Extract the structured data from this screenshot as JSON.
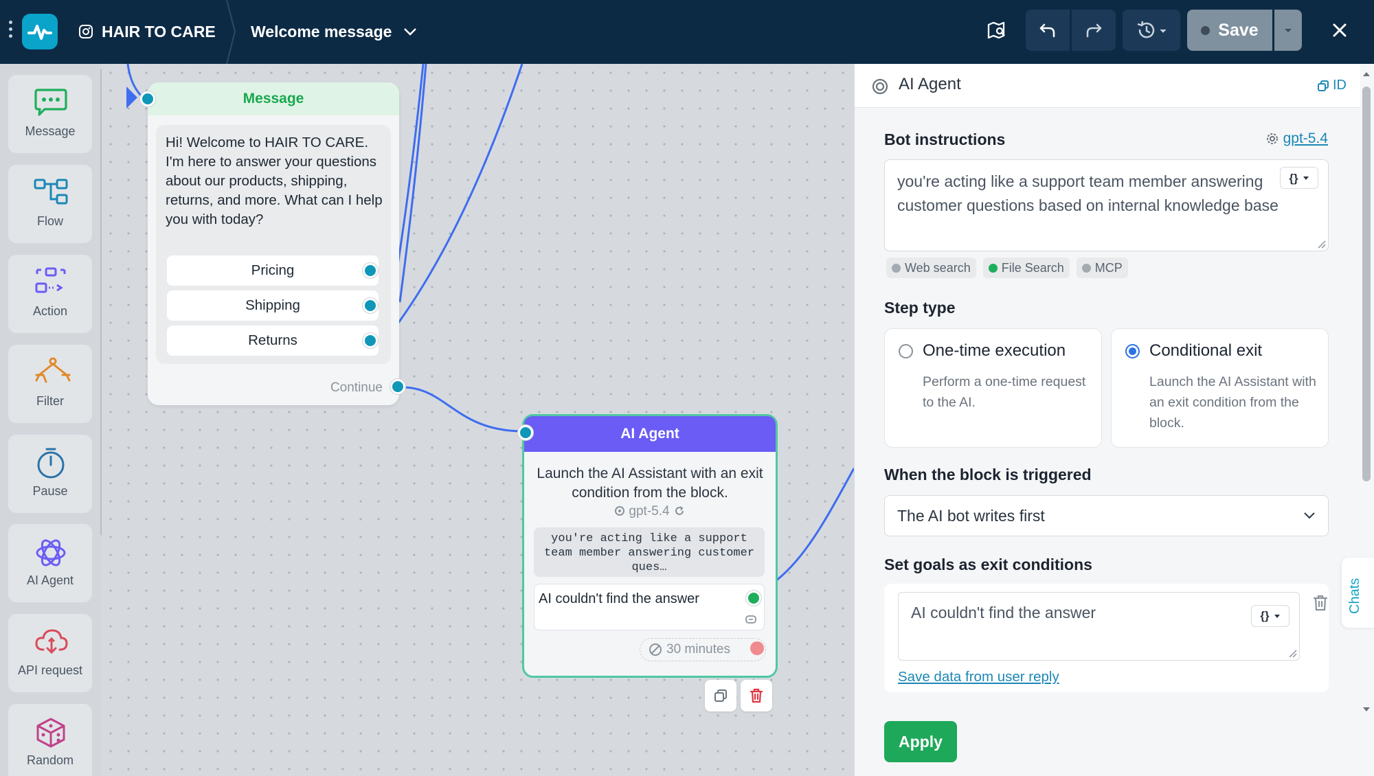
{
  "topbar": {
    "project_name": "HAIR TO CARE",
    "flow_name": "Welcome message",
    "save_label": "Save"
  },
  "palette": [
    {
      "label": "Message",
      "icon": "message-icon"
    },
    {
      "label": "Flow",
      "icon": "flow-icon"
    },
    {
      "label": "Action",
      "icon": "action-icon"
    },
    {
      "label": "Filter",
      "icon": "filter-icon"
    },
    {
      "label": "Pause",
      "icon": "pause-icon"
    },
    {
      "label": "AI Agent",
      "icon": "ai-agent-icon"
    },
    {
      "label": "API request",
      "icon": "api-request-icon"
    },
    {
      "label": "Random",
      "icon": "random-icon"
    }
  ],
  "message_node": {
    "title": "Message",
    "text": "Hi! Welcome to HAIR TO CARE. I'm here to answer your questions about our products, shipping, returns, and more. What can I help you with today?",
    "buttons": [
      "Pricing",
      "Shipping",
      "Returns"
    ],
    "continue_label": "Continue"
  },
  "ai_node": {
    "title": "AI Agent",
    "description": "Launch the AI Assistant with an exit condition from the block.",
    "model": "gpt-5.4",
    "instructions_preview": "you're acting like a support team member answering customer ques…",
    "goal": "AI couldn't find the answer",
    "timeout": "30 minutes"
  },
  "panel": {
    "title": "AI Agent",
    "id_label": "ID",
    "bot_instructions_label": "Bot instructions",
    "model_link": "gpt-5.4",
    "instructions_text": "you're acting like a support team member answering customer questions based on internal knowledge base",
    "tools": [
      {
        "label": "Web search",
        "enabled": false
      },
      {
        "label": "File Search",
        "enabled": true
      },
      {
        "label": "MCP",
        "enabled": false
      }
    ],
    "step_type_label": "Step type",
    "step_types": [
      {
        "title": "One-time execution",
        "desc": "Perform a one-time request to the AI.",
        "selected": false
      },
      {
        "title": "Conditional exit",
        "desc": "Launch the AI Assistant with an exit condition from the block.",
        "selected": true
      }
    ],
    "trigger_label": "When the block is triggered",
    "trigger_value": "The AI bot writes first",
    "goals_label": "Set goals as exit conditions",
    "goal_value": "AI couldn't find the answer",
    "save_data_link": "Save data from user reply",
    "apply_label": "Apply",
    "chats_tab": "Chats"
  },
  "colors": {
    "topbar_bg": "#0d2a45",
    "accent_teal": "#0aa3c9",
    "ai_header": "#6a5cf5",
    "message_header": "#dff4e6",
    "apply_green": "#1ea85a",
    "wire_blue": "#3f6df0"
  }
}
